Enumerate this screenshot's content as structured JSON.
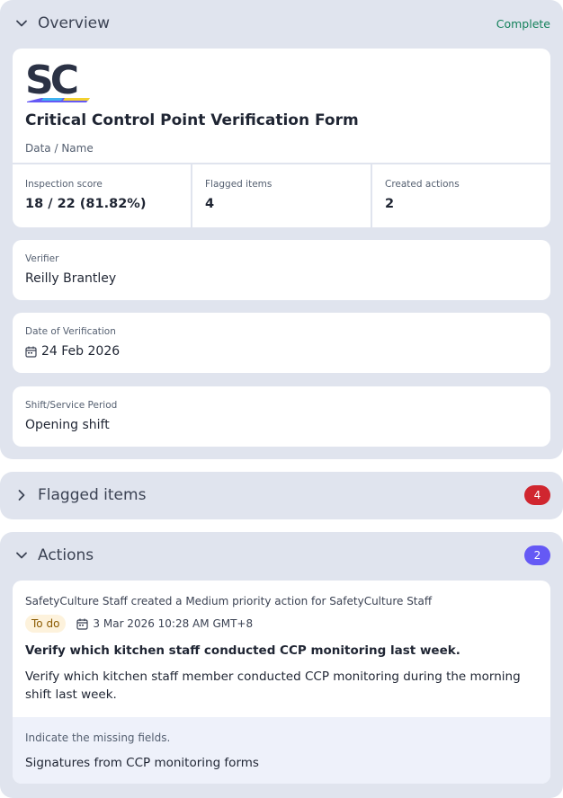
{
  "overview": {
    "title": "Overview",
    "status": "Complete",
    "logo_text": "SC",
    "form_title": "Critical Control Point Verification Form",
    "form_subtitle": "Data / Name",
    "stats": [
      {
        "label": "Inspection score",
        "value": "18 / 22 (81.82%)"
      },
      {
        "label": "Flagged items",
        "value": "4"
      },
      {
        "label": "Created actions",
        "value": "2"
      }
    ],
    "fields": [
      {
        "label": "Verifier",
        "value": "Reilly Brantley"
      },
      {
        "label": "Date of Verification",
        "value": "24 Feb 2026",
        "icon": "calendar-icon"
      },
      {
        "label": "Shift/Service Period",
        "value": "Opening shift"
      }
    ]
  },
  "flagged": {
    "title": "Flagged items",
    "count": "4"
  },
  "actions": {
    "title": "Actions",
    "count": "2",
    "items": [
      {
        "meta": "SafetyCulture Staff created a Medium priority action for SafetyCulture Staff",
        "status": "To do",
        "due": "3 Mar 2026 10:28 AM GMT+8",
        "title": "Verify which kitchen staff conducted CCP monitoring last week.",
        "description": "Verify which kitchen staff member conducted CCP monitoring during the morning shift last week.",
        "missing_label": "Indicate the missing fields.",
        "missing_value": "Signatures from CCP monitoring forms"
      }
    ]
  },
  "colors": {
    "section_bg": "#e0e4ee",
    "complete": "#13805a",
    "flag_badge": "#d0262f",
    "actions_badge": "#6559f5",
    "todo_bg": "#fdf2dc"
  }
}
